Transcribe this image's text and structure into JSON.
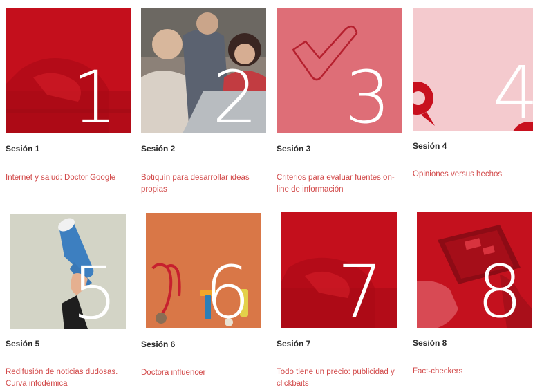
{
  "colors": {
    "brand_red": "#c8101e",
    "link_red": "#d24a4a",
    "title_text": "#2b2b2b"
  },
  "sessions": [
    {
      "number": "1",
      "title": "Sesión 1",
      "desc": "Internet y salud: Doctor Google"
    },
    {
      "number": "2",
      "title": "Sesión 2",
      "desc": "Botiquín para desarrollar ideas propias"
    },
    {
      "number": "3",
      "title": "Sesión 3",
      "desc": "Criterios para evaluar fuentes on-line de información"
    },
    {
      "number": "4",
      "title": "Sesión 4",
      "desc": "Opiniones versus hechos"
    },
    {
      "number": "5",
      "title": "Sesión 5",
      "desc": "Redifusión de noticias dudosas. Curva infodémica"
    },
    {
      "number": "6",
      "title": "Sesión 6",
      "desc": "Doctora influencer"
    },
    {
      "number": "7",
      "title": "Sesión 7",
      "desc": "Todo tiene un precio: publicidad y clickbaits"
    },
    {
      "number": "8",
      "title": "Sesión 8",
      "desc": "Fact-checkers"
    }
  ]
}
